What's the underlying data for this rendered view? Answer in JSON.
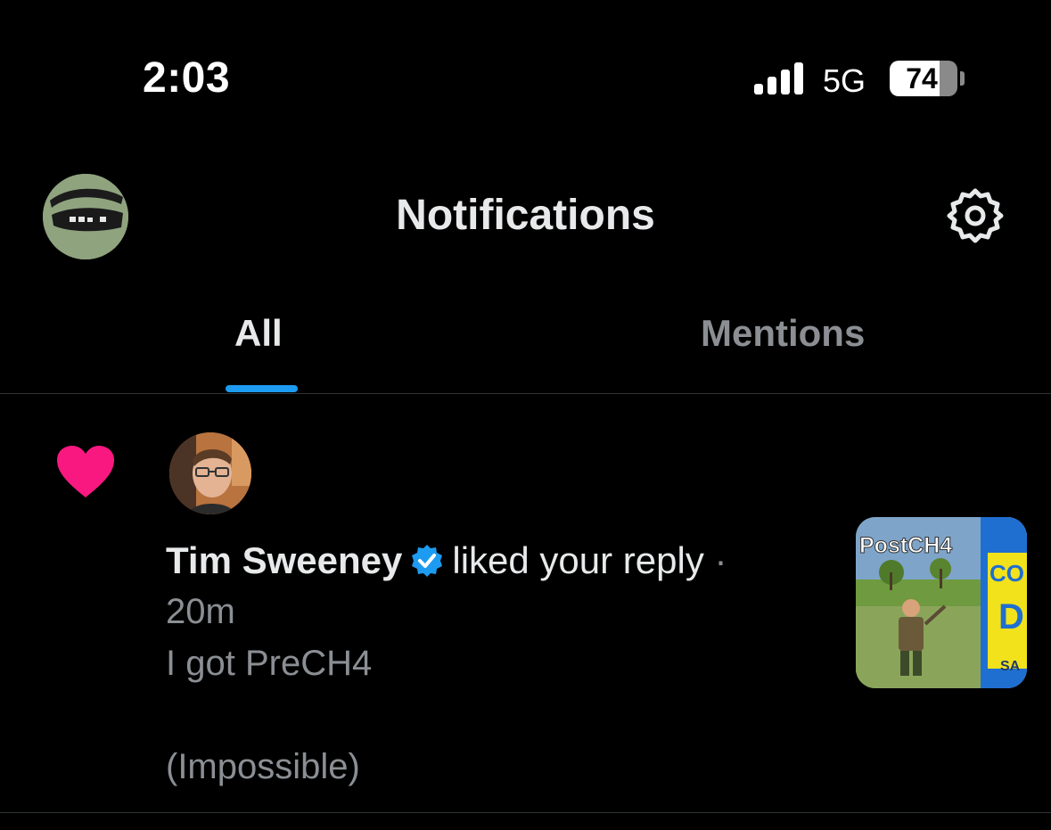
{
  "status_bar": {
    "time": "2:03",
    "network": "5G",
    "battery": "74",
    "battery_level": 0.74
  },
  "header": {
    "title": "Notifications",
    "avatar_icon": "profile-avatar",
    "settings_icon": "gear-icon"
  },
  "tabs": [
    {
      "label": "All",
      "active": true
    },
    {
      "label": "Mentions",
      "active": false
    }
  ],
  "notification": {
    "icon": "heart-icon",
    "user_name": "Tim Sweeney",
    "verified": true,
    "action": "liked your reply",
    "separator": "·",
    "time": "20m",
    "text_line1": "I got PreCH4",
    "text_line2": "(Impossible)",
    "thumbnail_caption": "PostCH4"
  },
  "colors": {
    "accent": "#1d9bf0",
    "like": "#f91880",
    "muted": "#8b8f94"
  }
}
